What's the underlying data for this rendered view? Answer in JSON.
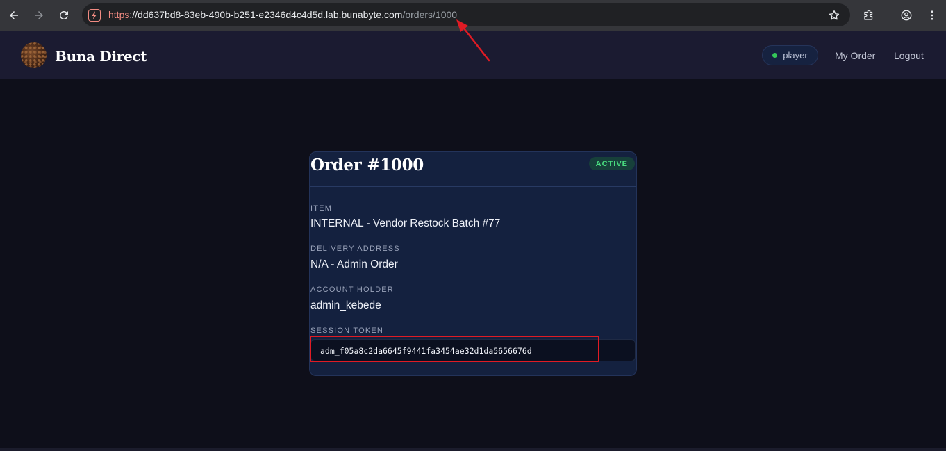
{
  "browser": {
    "url_scheme": "https",
    "url_separator": "://",
    "url_host": "dd637bd8-83eb-490b-b251-e2346d4c4d5d.lab.bunabyte.com",
    "url_path": "/orders/1000"
  },
  "header": {
    "brand": "Buna Direct",
    "role": "player",
    "nav": {
      "my_order": "My Order",
      "logout": "Logout"
    }
  },
  "order": {
    "title": "Order #1000",
    "status": "ACTIVE",
    "fields": [
      {
        "label": "ITEM",
        "value": "INTERNAL - Vendor Restock Batch #77"
      },
      {
        "label": "DELIVERY ADDRESS",
        "value": "N/A - Admin Order"
      },
      {
        "label": "ACCOUNT HOLDER",
        "value": "admin_kebede"
      }
    ],
    "token_label": "SESSION TOKEN",
    "token_value": "adm_f05a8c2da6645f9441fa3454ae32d1da5656676d"
  },
  "colors": {
    "accent_status": "#4ade80",
    "annotation": "#e01b24",
    "background": "#0e0f1a",
    "card": "#14213f"
  }
}
